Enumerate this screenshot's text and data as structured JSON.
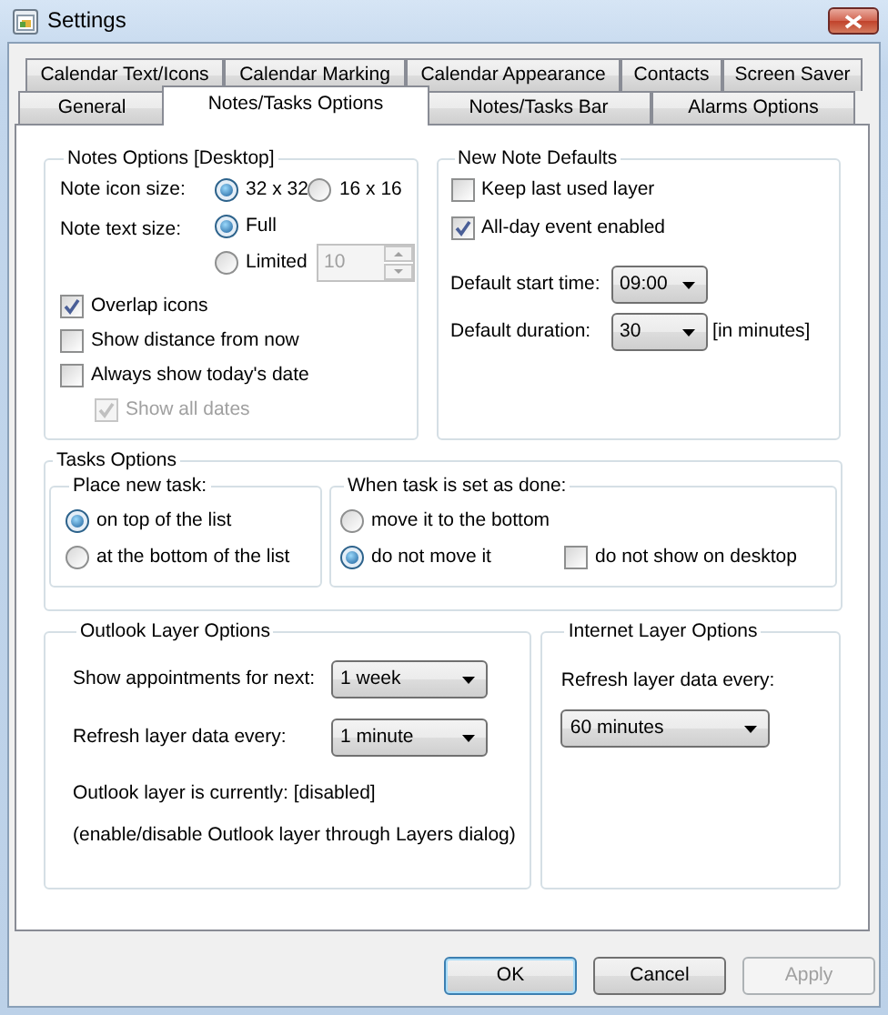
{
  "window": {
    "title": "Settings"
  },
  "tab_rows": [
    {
      "tabs": [
        {
          "label": "Calendar Text/Icons",
          "selected": false
        },
        {
          "label": "Calendar Marking",
          "selected": false
        },
        {
          "label": "Calendar Appearance",
          "selected": false
        },
        {
          "label": "Contacts",
          "selected": false
        },
        {
          "label": "Screen Saver",
          "selected": false
        }
      ]
    },
    {
      "tabs": [
        {
          "label": "General",
          "selected": false
        },
        {
          "label": "Notes/Tasks Options",
          "selected": true
        },
        {
          "label": "Notes/Tasks Bar",
          "selected": false
        },
        {
          "label": "Alarms Options",
          "selected": false
        }
      ]
    }
  ],
  "notes_options": {
    "title": "Notes Options [Desktop]",
    "icon_size": {
      "label": "Note icon size:",
      "options": [
        {
          "label": "32 x 32",
          "selected": true
        },
        {
          "label": "16 x 16",
          "selected": false
        }
      ]
    },
    "text_size": {
      "label": "Note text size:",
      "options": [
        {
          "label": "Full",
          "selected": true
        },
        {
          "label": "Limited",
          "selected": false
        }
      ],
      "limit": {
        "value": "10",
        "disabled": true
      }
    },
    "checkboxes": [
      {
        "label": "Overlap icons",
        "checked": true,
        "disabled": false
      },
      {
        "label": "Show distance from now",
        "checked": false,
        "disabled": false
      },
      {
        "label": "Always show today's date",
        "checked": false,
        "disabled": false,
        "children": [
          {
            "label": "Show all dates",
            "checked": true,
            "disabled": true
          }
        ]
      }
    ]
  },
  "new_note_defaults": {
    "title": "New Note Defaults",
    "checkboxes": [
      {
        "label": "Keep last used layer",
        "checked": false
      },
      {
        "label": "All-day event enabled",
        "checked": true
      }
    ],
    "start_time": {
      "label": "Default start time:",
      "value": "09:00"
    },
    "duration": {
      "label": "Default duration:",
      "value": "30",
      "unit": "[in minutes]"
    }
  },
  "tasks_options": {
    "title": "Tasks Options",
    "place_new_task": {
      "title": "Place new task:",
      "options": [
        {
          "label": "on top of the list",
          "selected": true
        },
        {
          "label": "at the bottom of the list",
          "selected": false
        }
      ]
    },
    "when_done": {
      "title": "When task is set as done:",
      "options": [
        {
          "label": "move it to the bottom",
          "selected": false
        },
        {
          "label": "do not move it",
          "selected": true
        }
      ],
      "checkbox": {
        "label": "do not show on desktop",
        "checked": false
      }
    }
  },
  "outlook_layer": {
    "title": "Outlook Layer Options",
    "appointments": {
      "label": "Show appointments for next:",
      "value": "1 week"
    },
    "refresh": {
      "label": "Refresh layer data every:",
      "value": "1 minute"
    },
    "status": "Outlook layer is currently: [disabled]",
    "hint": "(enable/disable Outlook layer through Layers dialog)"
  },
  "internet_layer": {
    "title": "Internet Layer Options",
    "refresh": {
      "label": "Refresh layer data every:",
      "value": "60 minutes"
    }
  },
  "buttons": [
    {
      "label": "OK",
      "default": true,
      "disabled": false
    },
    {
      "label": "Cancel",
      "default": false,
      "disabled": false
    },
    {
      "label": "Apply",
      "default": false,
      "disabled": true
    }
  ]
}
